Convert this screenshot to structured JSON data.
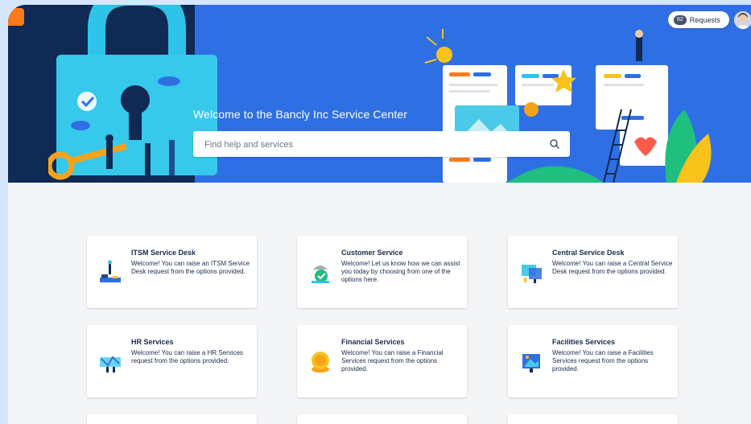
{
  "header": {
    "welcome_title": "Welcome to the Bancly Inc Service Center",
    "search_placeholder": "Find help and services",
    "requests_count": "62",
    "requests_label": "Requests"
  },
  "colors": {
    "hero_blue": "#2f6fe4",
    "hero_dark": "#0f2a54",
    "logo_orange": "#ff7a1a",
    "text_dark": "#172b4d"
  },
  "portals": [
    {
      "title": "ITSM Service Desk",
      "description": "Welcome! You can raise an ITSM Service Desk request from the options provided.",
      "icon": "itsm-desk-icon"
    },
    {
      "title": "Customer Service",
      "description": "Welcome! Let us know how we can assist you today by choosing from one of the options here.",
      "icon": "customer-service-icon"
    },
    {
      "title": "Central Service Desk",
      "description": "Welcome! You can raise a Central Service Desk request from the options provided.",
      "icon": "central-desk-icon"
    },
    {
      "title": "HR Services",
      "description": "Welcome! You can raise a HR Services request from the options provided.",
      "icon": "hr-services-icon"
    },
    {
      "title": "Financial Services",
      "description": "Welcome! You can raise a Financial Services request from the options provided.",
      "icon": "financial-services-icon"
    },
    {
      "title": "Facilities Services",
      "description": "Welcome! You can raise a Facilities Services request from the options provided.",
      "icon": "facilities-services-icon"
    }
  ]
}
